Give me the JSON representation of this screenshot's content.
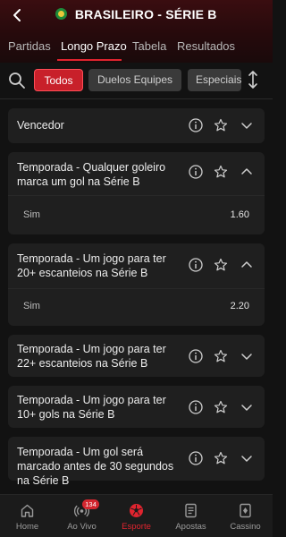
{
  "header": {
    "title": "BRASILEIRO - SÉRIE B"
  },
  "tabs": [
    "Partidas",
    "Longo Prazo",
    "Tabela",
    "Resultados"
  ],
  "filters": {
    "chips": [
      "Todos",
      "Duelos Equipes",
      "Especiais"
    ]
  },
  "markets": [
    {
      "title": "Vencedor",
      "expanded": false,
      "selections": []
    },
    {
      "title": "Temporada - Qualquer goleiro marca um gol na Série B",
      "expanded": true,
      "selections": [
        {
          "name": "Sim",
          "odds": "1.60"
        }
      ]
    },
    {
      "title": "Temporada - Um jogo para ter 20+ escanteios na Série B",
      "expanded": true,
      "selections": [
        {
          "name": "Sim",
          "odds": "2.20"
        }
      ]
    },
    {
      "title": "Temporada - Um jogo para ter 22+ escanteios na Série B",
      "expanded": false,
      "selections": []
    },
    {
      "title": "Temporada - Um jogo para ter 10+ gols na Série B",
      "expanded": false,
      "selections": []
    },
    {
      "title": "Temporada - Um gol será marcado antes de 30 segundos na Série B",
      "expanded": false,
      "selections": []
    }
  ],
  "bottom_nav": [
    {
      "label": "Home",
      "icon": "home-icon"
    },
    {
      "label": "Ao Vivo",
      "icon": "live-icon",
      "badge": "134"
    },
    {
      "label": "Esporte",
      "icon": "soccer-ball-icon",
      "active": true
    },
    {
      "label": "Apostas",
      "icon": "betslip-icon"
    },
    {
      "label": "Cassino",
      "icon": "casino-icon"
    }
  ],
  "colors": {
    "accent": "#e0242f",
    "background": "#121212",
    "card": "#1f1f1f"
  }
}
